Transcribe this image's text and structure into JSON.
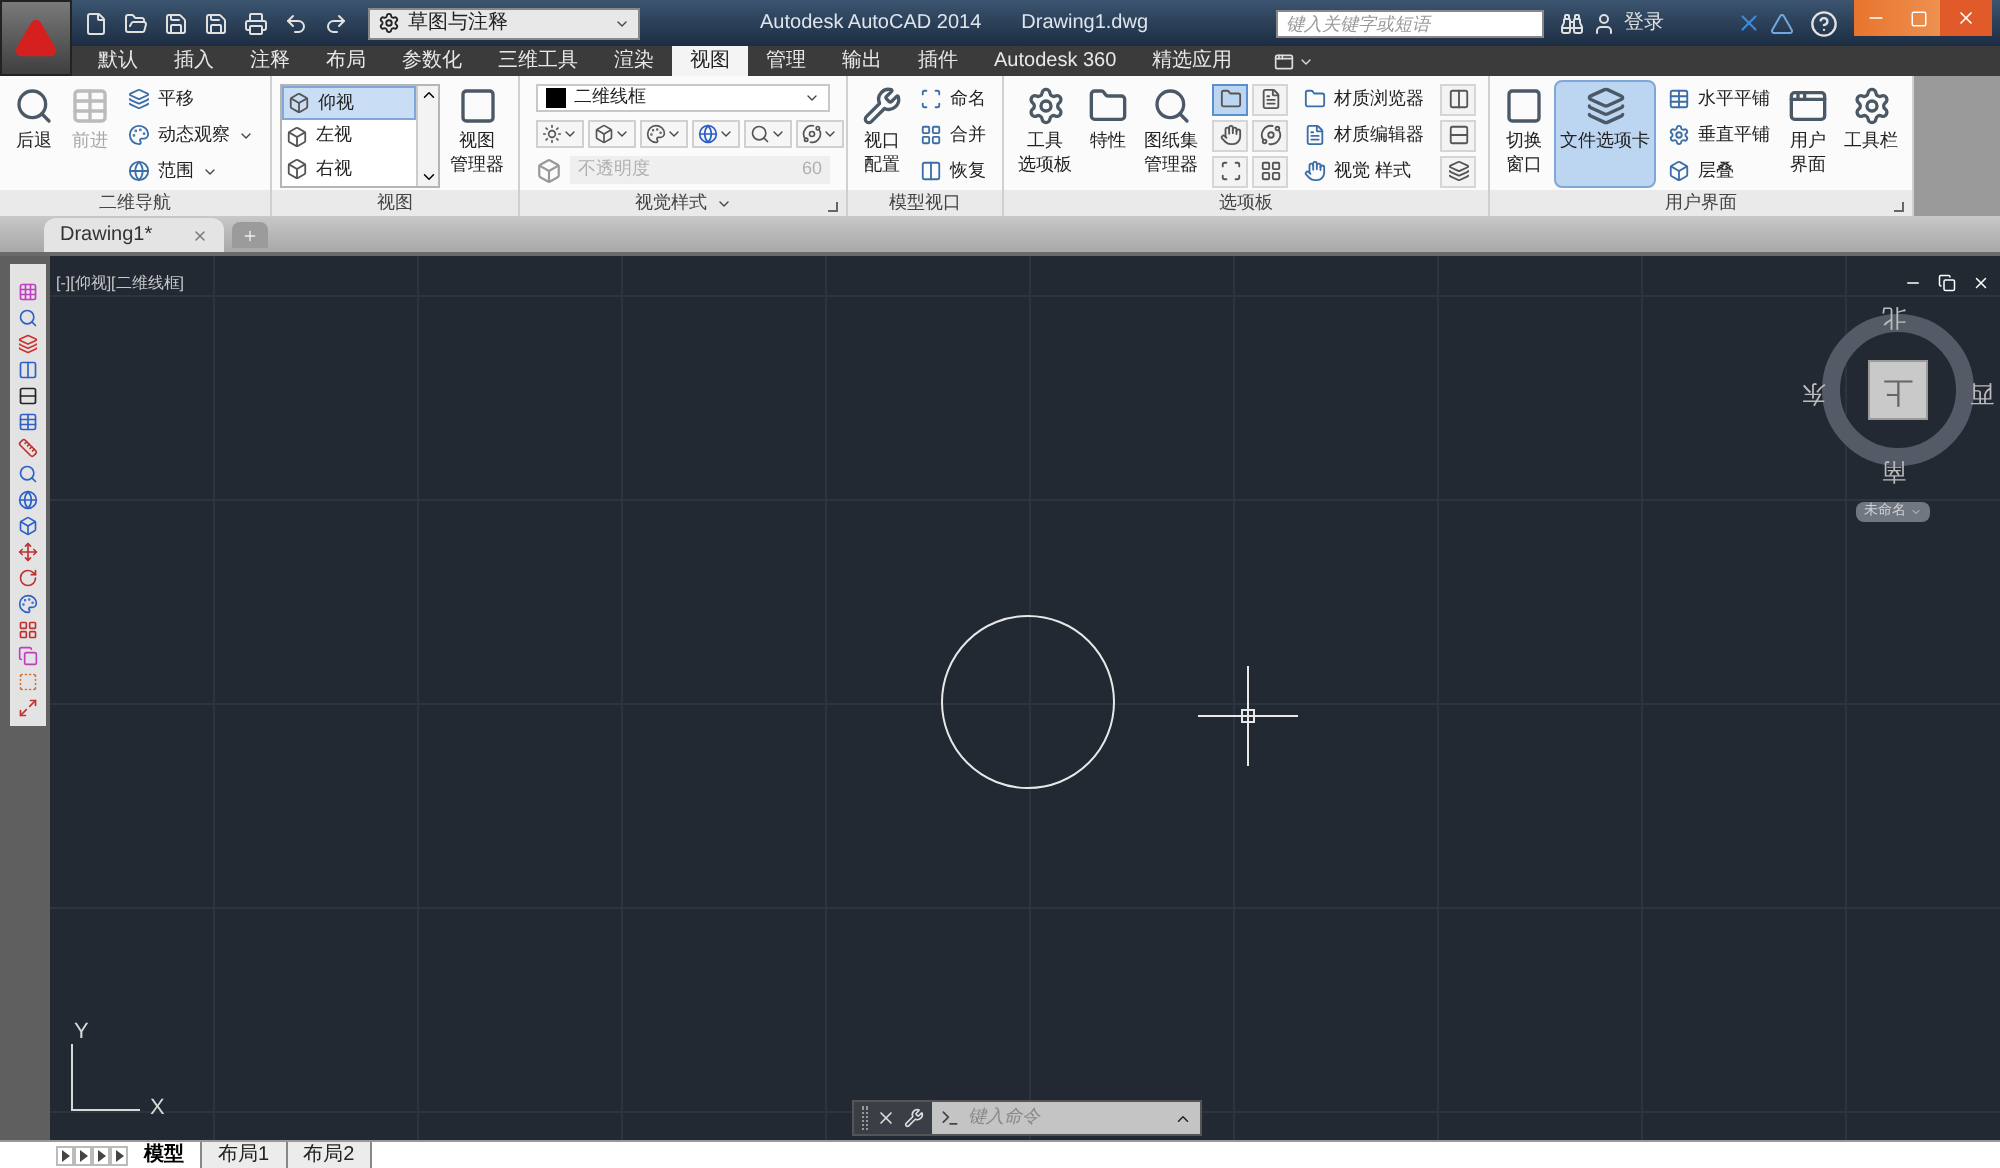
{
  "title_bar": {
    "workspace": "草图与注释",
    "app_title": "Autodesk AutoCAD 2014",
    "file_name": "Drawing1.dwg",
    "search": {
      "placeholder": "键入关键字或短语"
    },
    "sign_in": "登录"
  },
  "ribbon_tabs": [
    {
      "label": "默认",
      "selected": false
    },
    {
      "label": "插入",
      "selected": false
    },
    {
      "label": "注释",
      "selected": false
    },
    {
      "label": "布局",
      "selected": false
    },
    {
      "label": "参数化",
      "selected": false
    },
    {
      "label": "三维工具",
      "selected": false
    },
    {
      "label": "渲染",
      "selected": false
    },
    {
      "label": "视图",
      "selected": true
    },
    {
      "label": "管理",
      "selected": false
    },
    {
      "label": "输出",
      "selected": false
    },
    {
      "label": "插件",
      "selected": false
    },
    {
      "label": "Autodesk 360",
      "selected": false
    },
    {
      "label": "精选应用",
      "selected": false
    }
  ],
  "ribbon_panels": [
    {
      "label": "二维导航",
      "menu": false,
      "launcher": false,
      "groups": [
        {
          "kind": "large",
          "label": [
            "后退"
          ],
          "disabled": false,
          "selected": false
        },
        {
          "kind": "large",
          "label": [
            "前进"
          ],
          "disabled": true,
          "selected": false
        },
        {
          "kind": "stack",
          "items": [
            {
              "label": "平移",
              "menu": false
            },
            {
              "label": "动态观察",
              "menu": true
            },
            {
              "label": "范围",
              "menu": true
            }
          ]
        }
      ]
    },
    {
      "label": "视图",
      "menu": false,
      "launcher": false,
      "groups": [
        {
          "kind": "list",
          "items": [
            {
              "label": "仰视",
              "selected": true
            },
            {
              "label": "左视",
              "selected": false
            },
            {
              "label": "右视",
              "selected": false
            }
          ]
        },
        {
          "kind": "large",
          "label": [
            "视图",
            "管理器"
          ],
          "disabled": false,
          "selected": false
        }
      ]
    },
    {
      "label": "视觉样式",
      "menu": true,
      "launcher": true,
      "groups": [
        {
          "kind": "styles",
          "value": "二维线框",
          "opacity_label": "不透明度",
          "opacity_value": "60",
          "disabled": true
        }
      ]
    },
    {
      "label": "模型视口",
      "menu": false,
      "launcher": false,
      "groups": [
        {
          "kind": "large",
          "label": [
            "视口",
            "配置"
          ],
          "disabled": false,
          "selected": false
        },
        {
          "kind": "stack",
          "items": [
            {
              "label": "命名",
              "menu": false
            },
            {
              "label": "合并",
              "menu": false
            },
            {
              "label": "恢复",
              "menu": false
            }
          ]
        }
      ]
    },
    {
      "label": "选项板",
      "menu": false,
      "launcher": false,
      "groups": [
        {
          "kind": "large",
          "label": [
            "工具",
            "选项板"
          ],
          "disabled": false,
          "selected": false
        },
        {
          "kind": "large",
          "label": [
            "特性"
          ],
          "disabled": false,
          "selected": false
        },
        {
          "kind": "large",
          "label": [
            "图纸集",
            "管理器"
          ],
          "disabled": false,
          "selected": false
        },
        {
          "kind": "grid",
          "items": [
            {
              "selected": true
            },
            {
              "selected": false
            },
            {
              "selected": false
            },
            {
              "selected": false
            },
            {
              "selected": false
            },
            {
              "selected": false
            }
          ]
        },
        {
          "kind": "stack",
          "items": [
            {
              "label": "材质浏览器",
              "menu": false
            },
            {
              "label": "材质编辑器",
              "menu": false
            },
            {
              "label": "视觉 样式",
              "menu": false
            }
          ]
        },
        {
          "kind": "grid",
          "items": [
            {
              "selected": false
            },
            {
              "selected": false
            },
            {
              "selected": false
            }
          ]
        }
      ]
    },
    {
      "label": "用户界面",
      "menu": false,
      "launcher": true,
      "groups": [
        {
          "kind": "large",
          "label": [
            "切换",
            "窗口"
          ],
          "disabled": false,
          "selected": false
        },
        {
          "kind": "large",
          "label": [
            "文件选项卡"
          ],
          "disabled": false,
          "selected": true
        },
        {
          "kind": "stack",
          "items": [
            {
              "label": "水平平铺",
              "menu": false
            },
            {
              "label": "垂直平铺",
              "menu": false
            },
            {
              "label": "层叠",
              "menu": false
            }
          ]
        },
        {
          "kind": "large",
          "label": [
            "用户",
            "界面"
          ],
          "disabled": false,
          "selected": false
        },
        {
          "kind": "large",
          "label": [
            "工具栏"
          ],
          "disabled": false,
          "selected": false
        }
      ]
    }
  ],
  "document_tabs": [
    {
      "label": "Drawing1*",
      "selected": true
    }
  ],
  "viewport": {
    "label": "[-][仰视][二维线框]",
    "viewcube": {
      "north": "北",
      "south": "南",
      "east": "东",
      "west": "西",
      "face": "上",
      "coordinate_system": "未命名"
    },
    "ucs": {
      "x": "X",
      "y": "Y"
    }
  },
  "command_line": {
    "placeholder": "键入命令"
  },
  "layout_tabs": [
    {
      "label": "模型",
      "selected": true
    },
    {
      "label": "布局1",
      "selected": false
    },
    {
      "label": "布局2",
      "selected": false
    }
  ]
}
